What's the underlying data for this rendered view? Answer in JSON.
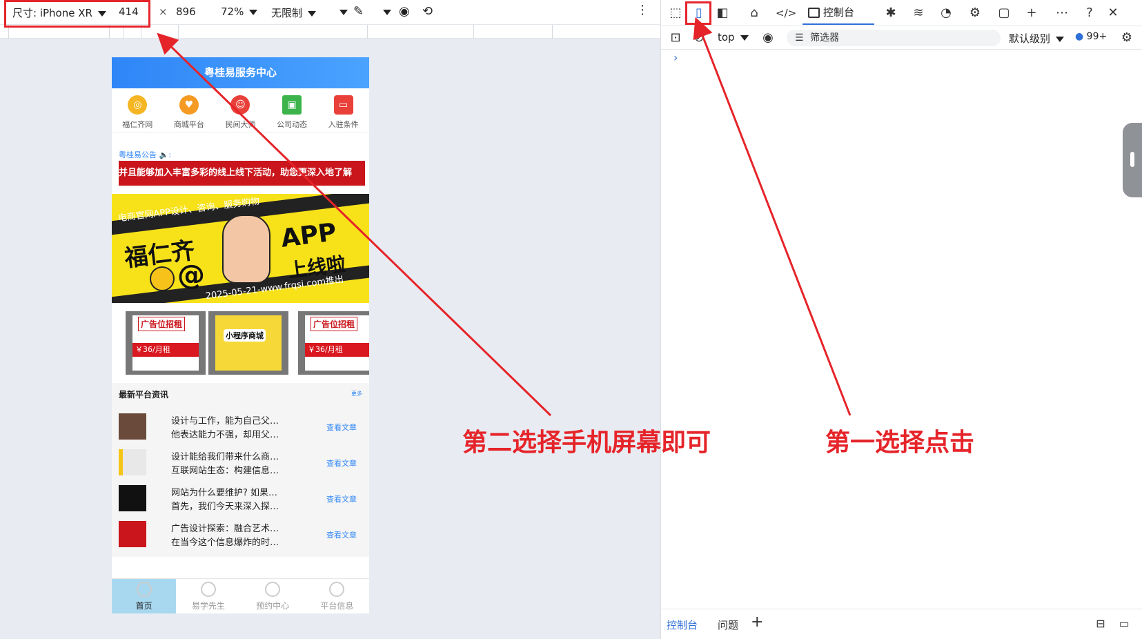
{
  "device_toolbar": {
    "size_label": "尺寸: iPhone XR",
    "width": "414",
    "times": "×",
    "height": "896",
    "zoom": "72%",
    "throttle": "无限制"
  },
  "phone": {
    "header_title": "粤桂易服务中心",
    "quick_links": [
      {
        "label": "福仁齐网",
        "color": "#f5b623"
      },
      {
        "label": "商城平台",
        "color": "#f59a23"
      },
      {
        "label": "民间大师",
        "color": "#e9413a"
      },
      {
        "label": "公司动态",
        "color": "#3cb44b"
      },
      {
        "label": "入驻条件",
        "color": "#e9413a"
      }
    ],
    "notice_label": "粤桂易公告 🔈:",
    "marquee_text": "并且能够加入丰富多彩的线上线下活动，助您更深入地了解",
    "banner": {
      "line1": "电商官网APP设计、咨询、服务购物",
      "name": "福仁齐",
      "app": "APP",
      "online": "上线啦",
      "at": "@",
      "footer": "2025-05-21-www.frqsi.com推出"
    },
    "ads": [
      {
        "title": "广告位招租",
        "price": "￥36/月租"
      },
      {
        "title": "小程序商城",
        "price": ""
      },
      {
        "title": "广告位招租",
        "price": "￥36/月租"
      }
    ],
    "news_section_title": "最新平台资讯",
    "news_more": "更多",
    "news": [
      {
        "line1": "设计与工作，能为自己父…",
        "line2": "他表达能力不强，却用父…",
        "action": "查看文章",
        "thumb_color": "#6a4a3a"
      },
      {
        "line1": "设计能给我们带来什么商…",
        "line2": "互联网站生态：构建信息…",
        "action": "查看文章",
        "thumb_color": "#e8e8e8"
      },
      {
        "line1": "网站为什么要维护? 如果…",
        "line2": "首先，我们今天来深入探…",
        "action": "查看文章",
        "thumb_color": "#111111"
      },
      {
        "line1": "广告设计探索：融合艺术…",
        "line2": "在当今这个信息爆炸的时…",
        "action": "查看文章",
        "thumb_color": "#c9151b"
      }
    ],
    "tabs": [
      {
        "label": "首页",
        "active": true
      },
      {
        "label": "易学先生",
        "active": false
      },
      {
        "label": "预约中心",
        "active": false
      },
      {
        "label": "平台信息",
        "active": false
      }
    ]
  },
  "devtools": {
    "console_tab": "控制台",
    "context": "top",
    "filter_placeholder": "筛选器",
    "level": "默认级别",
    "issue_count": "99+",
    "prompt": "›",
    "bottom_tabs": {
      "console": "控制台",
      "issues": "问题",
      "add": "+"
    }
  },
  "annotations": {
    "second": "第二选择手机屏幕即可",
    "first": "第一选择点击"
  },
  "colors": {
    "annotation_red": "#e5242a",
    "accent_blue": "#2f6fd9"
  }
}
